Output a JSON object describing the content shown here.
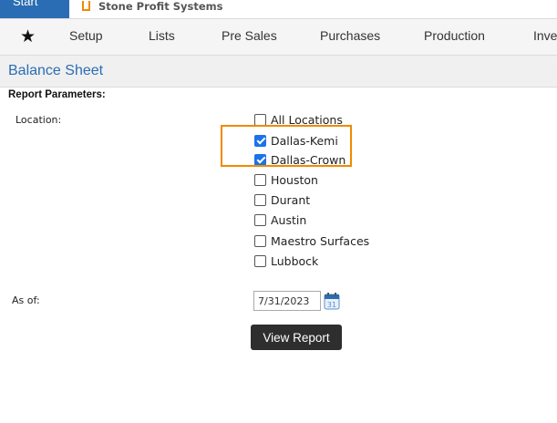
{
  "topbar": {
    "start_label": "Start",
    "brand_name": "Stone Profit Systems"
  },
  "nav": {
    "items": [
      {
        "label": "Setup"
      },
      {
        "label": "Lists"
      },
      {
        "label": "Pre Sales"
      },
      {
        "label": "Purchases"
      },
      {
        "label": "Production"
      },
      {
        "label": "Inve"
      }
    ]
  },
  "page": {
    "title": "Balance Sheet",
    "report_parameters_label": "Report Parameters:",
    "location_label": "Location:",
    "as_of_label": "As of:"
  },
  "locations": [
    {
      "label": "All Locations",
      "checked": false
    },
    {
      "label": "Dallas-Kemi",
      "checked": true
    },
    {
      "label": "Dallas-Crown",
      "checked": true
    },
    {
      "label": "Houston",
      "checked": false
    },
    {
      "label": "Durant",
      "checked": false
    },
    {
      "label": "Austin",
      "checked": false
    },
    {
      "label": "Maestro Surfaces",
      "checked": false
    },
    {
      "label": "Lubbock",
      "checked": false
    }
  ],
  "as_of": {
    "value": "7/31/2023",
    "calendar_day": "31"
  },
  "actions": {
    "view_report_label": "View Report"
  },
  "colors": {
    "accent_blue": "#2a6db4",
    "highlight_orange": "#f08a00",
    "checkbox_blue": "#1a73e8",
    "button_dark": "#2e2e2e"
  }
}
